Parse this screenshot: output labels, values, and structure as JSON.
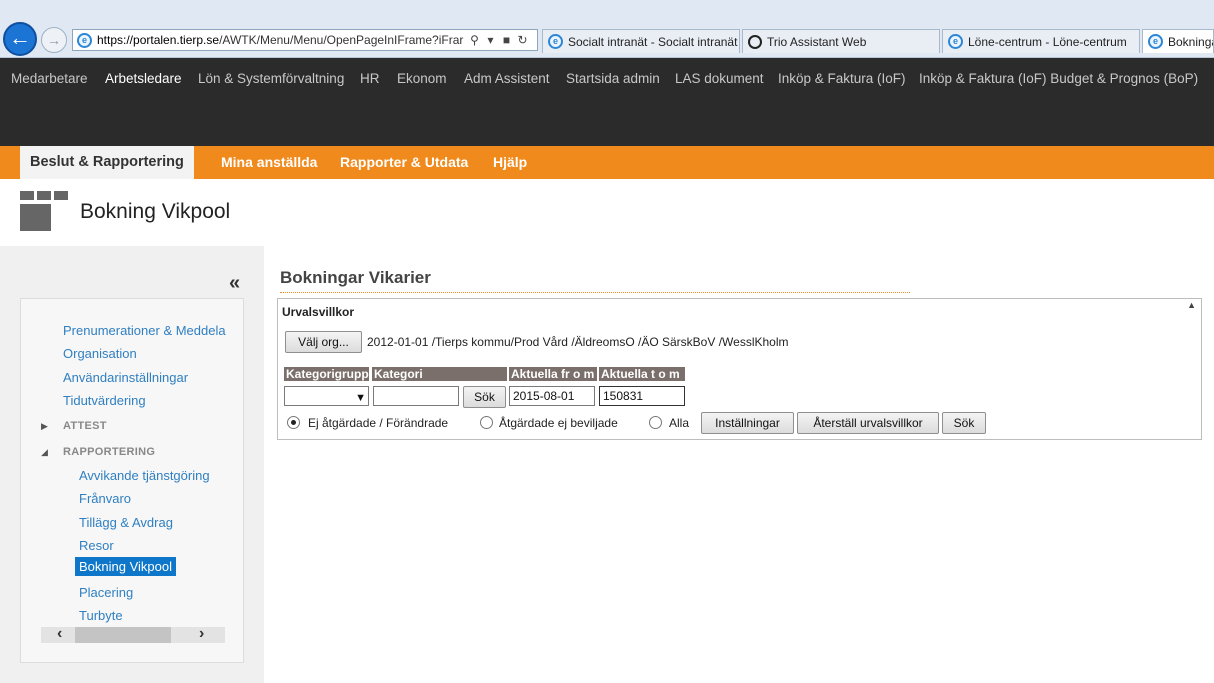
{
  "browser": {
    "url_host": "https://portalen.tierp.se",
    "url_path": "/AWTK/Menu/Menu/OpenPageInIFrame?iFrar",
    "tabs": [
      {
        "label": "Socialt intranät - Socialt intranät"
      },
      {
        "label": "Trio Assistant Web"
      },
      {
        "label": "Löne-centrum - Löne-centrum"
      },
      {
        "label": "Bokninga"
      }
    ]
  },
  "topnav": {
    "items": [
      "Medarbetare",
      "Arbetsledare",
      "Lön & Systemförvaltning",
      "HR",
      "Ekonom",
      "Adm Assistent",
      "Startsida admin",
      "LAS dokument",
      "Inköp & Faktura (IoF)",
      "Inköp & Faktura (IoF) Budget & Prognos (BoP)"
    ],
    "active": "Arbetsledare"
  },
  "subnav": {
    "items": [
      "Beslut & Rapportering",
      "Mina anställda",
      "Rapporter & Utdata",
      "Hjälp"
    ]
  },
  "page": {
    "title": "Bokning Vikpool"
  },
  "sidebar": {
    "collapse_label": "«",
    "links": [
      "Prenumerationer & Meddela",
      "Organisation",
      "Användarinställningar",
      "Tidutvärdering"
    ],
    "sections": [
      "ATTEST",
      "RAPPORTERING"
    ],
    "sub_links": [
      "Avvikande tjänstgöring",
      "Frånvaro",
      "Tillägg & Avdrag",
      "Resor",
      "Bokning Vikpool",
      "Placering",
      "Turbyte"
    ],
    "selected": "Bokning Vikpool"
  },
  "main": {
    "title": "Bokningar Vikarier",
    "panel_title": "Urvalsvillkor",
    "org_button": "Välj org...",
    "org_text": "2012-01-01 /Tierps kommu/Prod Vård /ÄldreomsO /ÄO SärskBoV /WesslKholm",
    "columns": [
      "Kategorigrupp",
      "Kategori",
      "Aktuella fr o m",
      "Aktuella t o m"
    ],
    "search_button": "Sök",
    "from_value": "2015-08-01",
    "to_value": "150831",
    "radios": [
      "Ej åtgärdade / Förändrade",
      "Åtgärdade ej beviljade",
      "Alla"
    ],
    "settings_button": "Inställningar",
    "reset_button": "Återställ urvalsvillkor",
    "search_button2": "Sök"
  }
}
